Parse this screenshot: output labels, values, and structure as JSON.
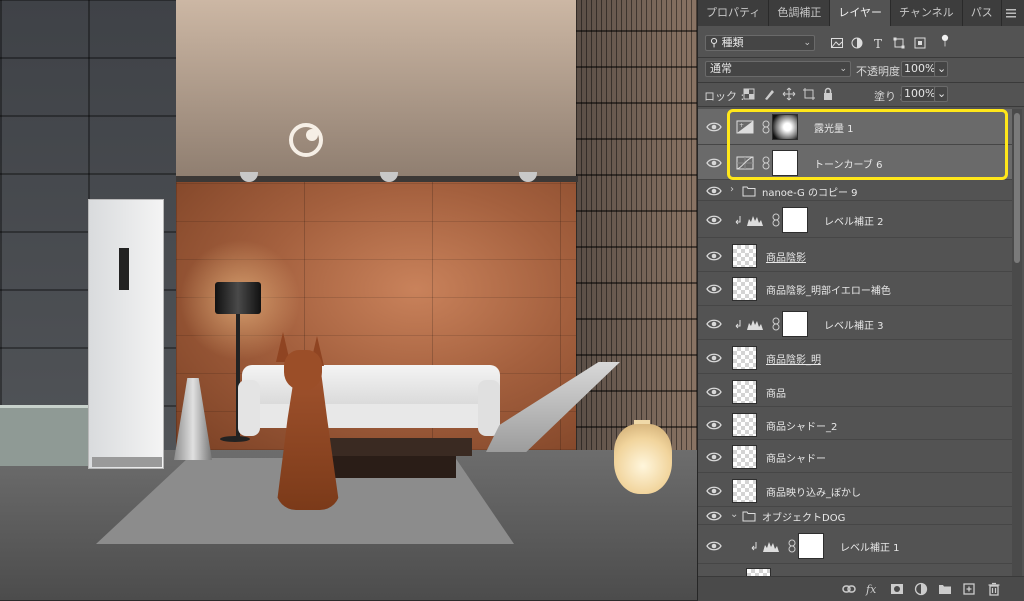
{
  "canvas": {
    "photo": "living-room-with-dog"
  },
  "panel": {
    "tabs": [
      {
        "label": "プロパティ",
        "active": false
      },
      {
        "label": "色調補正",
        "active": false
      },
      {
        "label": "レイヤー",
        "active": true
      },
      {
        "label": "チャンネル",
        "active": false
      },
      {
        "label": "パス",
        "active": false
      }
    ],
    "filter": {
      "kind_label": "種類",
      "icons": [
        "image-filter-icon",
        "adjustment-filter-icon",
        "type-filter-icon",
        "shape-filter-icon",
        "smart-object-filter-icon",
        "filter-toggle-icon"
      ]
    },
    "blend": {
      "mode": "通常",
      "opacity_label": "不透明度 :",
      "opacity_value": "100%"
    },
    "lock": {
      "label": "ロック :",
      "fill_label": "塗り :",
      "fill_value": "100%"
    },
    "layers": [
      {
        "name": "露光量 1",
        "type": "adjustment",
        "adj_icon": "exposure-icon",
        "mask": "radial",
        "selected": true,
        "clipped": false,
        "indent": 0,
        "underline": false
      },
      {
        "name": "トーンカーブ 6",
        "type": "adjustment",
        "adj_icon": "curves-icon",
        "mask": "white",
        "selected": true,
        "clipped": false,
        "indent": 0,
        "underline": false
      },
      {
        "name": "nanoe-G のコピー 9",
        "type": "group",
        "expanded": false,
        "indent": 0
      },
      {
        "name": "レベル補正 2",
        "type": "adjustment",
        "adj_icon": "levels-icon",
        "mask": "white",
        "selected": false,
        "clipped": true,
        "indent": 0,
        "underline": false
      },
      {
        "name": "商品陰影",
        "type": "pixel",
        "selected": false,
        "underline": true
      },
      {
        "name": "商品陰影_明部イエロー補色",
        "type": "pixel",
        "selected": false,
        "underline": false
      },
      {
        "name": "レベル補正 3",
        "type": "adjustment",
        "adj_icon": "levels-icon",
        "mask": "white",
        "selected": false,
        "clipped": true,
        "indent": 0,
        "underline": false
      },
      {
        "name": "商品陰影_明",
        "type": "pixel",
        "selected": false,
        "underline": true
      },
      {
        "name": "商品",
        "type": "pixel",
        "selected": false,
        "underline": false
      },
      {
        "name": "商品シャドー_2",
        "type": "pixel",
        "selected": false,
        "underline": false
      },
      {
        "name": "商品シャドー",
        "type": "pixel",
        "selected": false,
        "underline": false
      },
      {
        "name": "商品映り込み_ぼかし",
        "type": "pixel",
        "selected": false,
        "underline": false
      },
      {
        "name": "オブジェクトDOG",
        "type": "group",
        "expanded": true,
        "indent": 0
      },
      {
        "name": "レベル補正 1",
        "type": "adjustment",
        "adj_icon": "levels-icon",
        "mask": "white",
        "selected": false,
        "clipped": true,
        "indent": 1,
        "underline": false
      }
    ],
    "footer_icons": [
      "link-layers-icon",
      "fx-icon",
      "add-mask-icon",
      "new-adjustment-icon",
      "new-group-icon",
      "new-layer-icon",
      "delete-layer-icon"
    ],
    "colors": {
      "panel_bg": "#535353",
      "selected_row": "#6a6a6a",
      "highlight": "#ffe71a"
    }
  }
}
